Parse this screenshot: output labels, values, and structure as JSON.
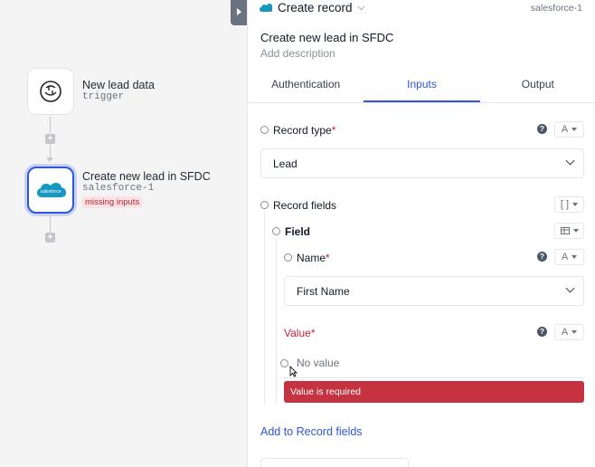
{
  "canvas": {
    "trigger_node": {
      "title": "New lead data",
      "subtitle": "trigger",
      "icon": "trigger-icon"
    },
    "action_node": {
      "title": "Create new lead in SFDC",
      "subtitle": "salesforce-1",
      "badge": "missing inputs",
      "icon": "salesforce-icon"
    }
  },
  "header": {
    "title": "Create record",
    "connector": "salesforce-1",
    "action_title": "Create new lead in SFDC",
    "description_placeholder": "Add description"
  },
  "tabs": [
    {
      "label": "Authentication",
      "active": false
    },
    {
      "label": "Inputs",
      "active": true
    },
    {
      "label": "Output",
      "active": false
    }
  ],
  "inputs": {
    "record_type": {
      "label": "Record type",
      "required_mark": "*",
      "value": "Lead",
      "type_label": "A"
    },
    "record_fields": {
      "label": "Record fields",
      "type_label": "[ ]"
    },
    "field": {
      "label": "Field"
    },
    "name": {
      "label": "Name",
      "required_mark": "*",
      "value": "First Name",
      "type_label": "A"
    },
    "value": {
      "label": "Value",
      "required_mark": "*",
      "placeholder": "No value",
      "type_label": "A",
      "error": "Value is required"
    },
    "add_link": "Add to Record fields"
  },
  "colors": {
    "accent": "#2f56d6",
    "error": "#c53341",
    "salesforce": "#1798c1"
  }
}
